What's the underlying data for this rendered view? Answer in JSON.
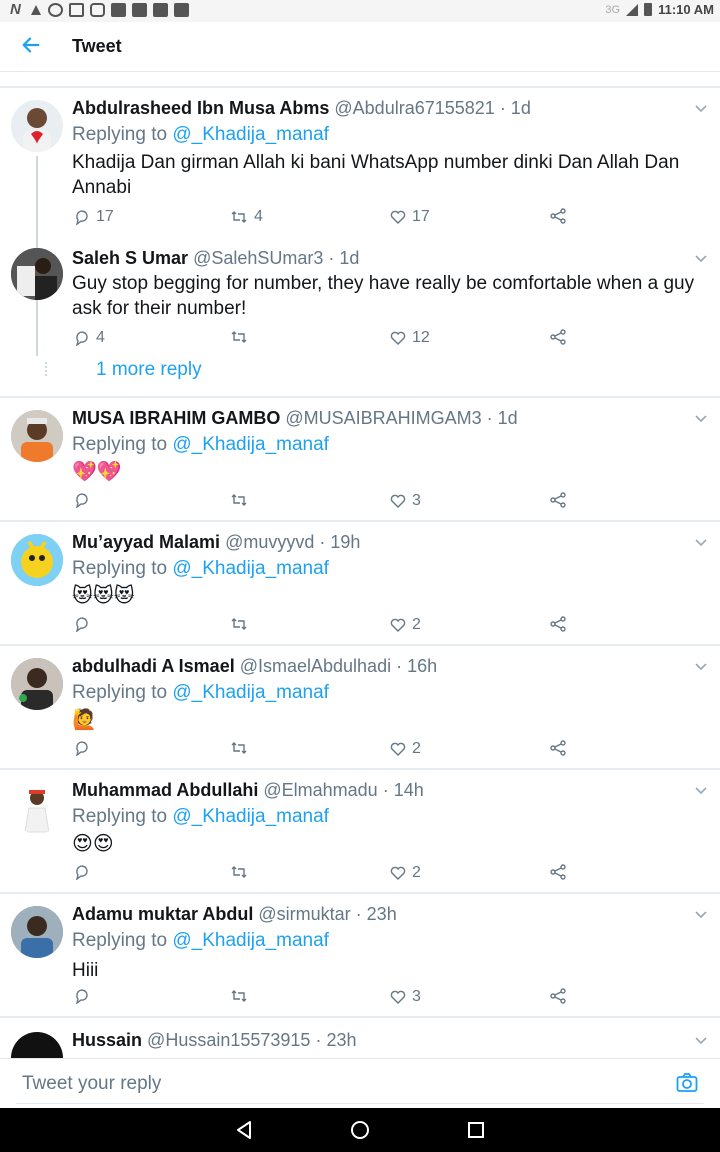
{
  "status_bar": {
    "network": "3G",
    "time": "11:10 AM",
    "icons": [
      "n-icon",
      "tick-icon",
      "whatsapp-icon",
      "file-icon",
      "instagram-icon",
      "image-icon",
      "gmail-icon",
      "gmail-icon",
      "chat-icon"
    ]
  },
  "header": {
    "title": "Tweet",
    "back_icon": "back-arrow-icon"
  },
  "colors": {
    "accent": "#1da1f2",
    "secondary_text": "#657786",
    "primary_text": "#14171a",
    "divider": "#e6ecf0"
  },
  "tweets": [
    {
      "name": "Abdulrasheed Ibn Musa Abms",
      "handle": "@Abdulra67155821",
      "time": "· 1d",
      "replying_label": "Replying to",
      "replying_to": "@_Khadija_manaf",
      "text": "Khadija Dan girman Allah ki bani WhatsApp number dinki Dan Allah Dan Annabi",
      "replies": "17",
      "retweets": "4",
      "likes": "17"
    },
    {
      "name": "Saleh S Umar",
      "handle": "@SalehSUmar3",
      "time": "· 1d",
      "text": "Guy stop begging for number, they have really be comfortable when a guy ask for their number!",
      "replies": "4",
      "retweets": "",
      "likes": "12",
      "more_replies": "1 more reply"
    },
    {
      "name": "MUSA IBRAHIM GAMBO",
      "handle": "@MUSAIBRAHIMGAM3",
      "time": "· 1d",
      "replying_label": "Replying to",
      "replying_to": "@_Khadija_manaf",
      "text": "💖💖",
      "replies": "",
      "retweets": "",
      "likes": "3"
    },
    {
      "name": "Mu’ayyad Malami",
      "handle": "@muvyyvd",
      "time": "· 19h",
      "replying_label": "Replying to",
      "replying_to": "@_Khadija_manaf",
      "text": "😻😻😻",
      "replies": "",
      "retweets": "",
      "likes": "2"
    },
    {
      "name": "abdulhadi A Ismael",
      "handle": "@IsmaelAbdulhadi",
      "time": "· 16h",
      "replying_label": "Replying to",
      "replying_to": "@_Khadija_manaf",
      "text": "🙋",
      "replies": "",
      "retweets": "",
      "likes": "2"
    },
    {
      "name": "Muhammad Abdullahi",
      "handle": "@Elmahmadu",
      "time": "· 14h",
      "replying_label": "Replying to",
      "replying_to": "@_Khadija_manaf",
      "text": "😍😍",
      "replies": "",
      "retweets": "",
      "likes": "2"
    },
    {
      "name": "Adamu muktar Abdul",
      "handle": "@sirmuktar",
      "time": "· 23h",
      "replying_label": "Replying to",
      "replying_to": "@_Khadija_manaf",
      "text": "Hiii",
      "replies": "",
      "retweets": "",
      "likes": "3"
    },
    {
      "name": "Hussain",
      "handle": "@Hussain15573915",
      "time": "· 23h"
    }
  ],
  "composer": {
    "placeholder": "Tweet your reply",
    "camera_icon": "camera-icon"
  },
  "nav_bar": {
    "icons": [
      "back-triangle-icon",
      "home-circle-icon",
      "recents-square-icon"
    ]
  }
}
